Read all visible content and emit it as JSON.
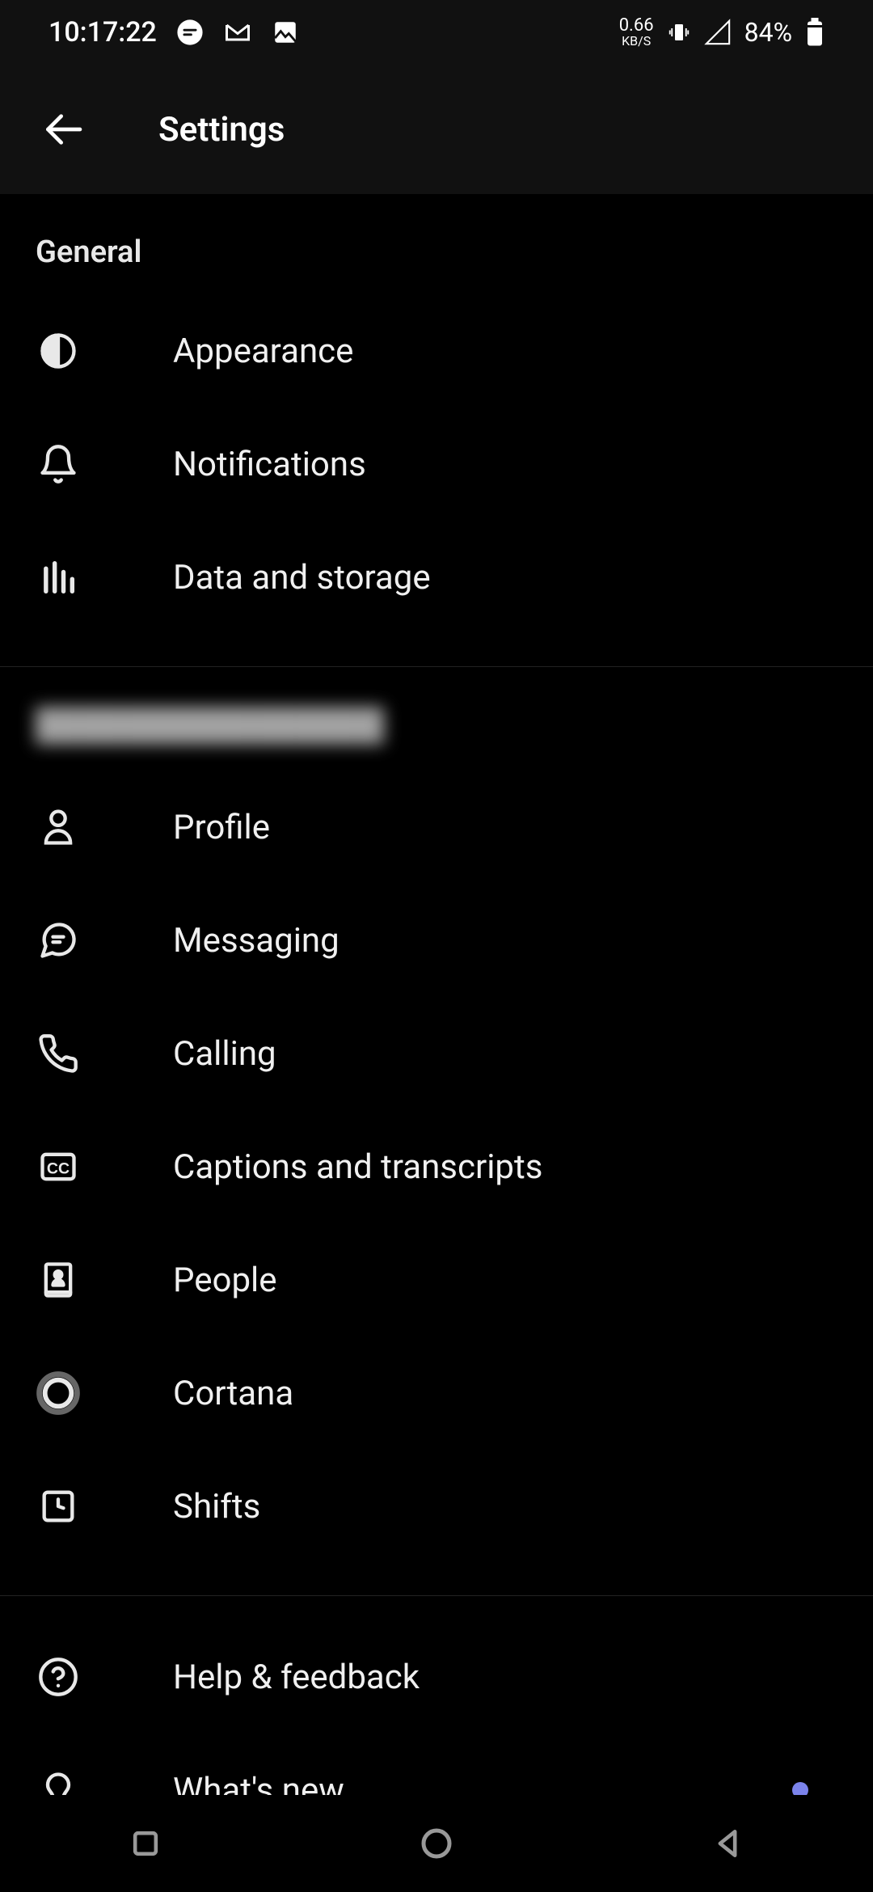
{
  "status_bar": {
    "time": "10:17:22",
    "network_speed_value": "0.66",
    "network_speed_unit": "KB/S",
    "battery_pct": "84%"
  },
  "header": {
    "title": "Settings"
  },
  "sections": [
    {
      "title": "General",
      "blurred": false,
      "items": [
        {
          "icon": "appearance-icon",
          "label": "Appearance"
        },
        {
          "icon": "notifications-icon",
          "label": "Notifications"
        },
        {
          "icon": "data-storage-icon",
          "label": "Data and storage"
        }
      ]
    },
    {
      "title": "████████████████",
      "blurred": true,
      "items": [
        {
          "icon": "profile-icon",
          "label": "Profile"
        },
        {
          "icon": "messaging-icon",
          "label": "Messaging"
        },
        {
          "icon": "calling-icon",
          "label": "Calling"
        },
        {
          "icon": "captions-icon",
          "label": "Captions and transcripts"
        },
        {
          "icon": "people-icon",
          "label": "People"
        },
        {
          "icon": "cortana-icon",
          "label": "Cortana"
        },
        {
          "icon": "shifts-icon",
          "label": " Shifts"
        }
      ]
    },
    {
      "title": "",
      "blurred": false,
      "items": [
        {
          "icon": "help-icon",
          "label": "Help & feedback"
        },
        {
          "icon": "whatsnew-icon",
          "label": "What's new",
          "dot": true
        }
      ]
    }
  ],
  "colors": {
    "accent": "#7b83eb",
    "bg": "#000000",
    "text": "#ffffff"
  }
}
